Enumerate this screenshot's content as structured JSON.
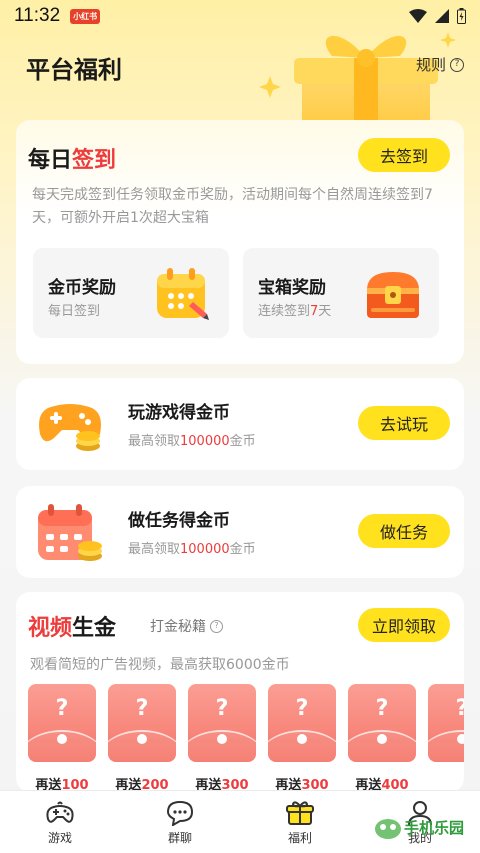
{
  "status_bar": {
    "time": "11:32",
    "badge": "小红书"
  },
  "header": {
    "title": "平台福利",
    "rules_label": "规则"
  },
  "signin": {
    "title_part1": "每日",
    "title_part2": "签到",
    "button_label": "去签到",
    "description": "每天完成签到任务领取金币奖励，活动期间每个自然周连续签到7天，可额外开启1次超大宝箱",
    "rewards": [
      {
        "title": "金币奖励",
        "subtitle": "每日签到",
        "icon": "calendar-coin-icon"
      },
      {
        "title": "宝箱奖励",
        "subtitle_pre": "连续签到",
        "subtitle_highlight": "7",
        "subtitle_post": "天",
        "icon": "treasure-chest-icon"
      }
    ]
  },
  "tasks": [
    {
      "title": "玩游戏得金币",
      "sub_pre": "最高领取",
      "sub_highlight": "100000",
      "sub_post": "金币",
      "button_label": "去试玩",
      "icon": "gamepad-coin-icon"
    },
    {
      "title": "做任务得金币",
      "sub_pre": "最高领取",
      "sub_highlight": "100000",
      "sub_post": "金币",
      "button_label": "做任务",
      "icon": "task-calendar-icon"
    }
  ],
  "video": {
    "title_part1": "视频",
    "title_part2": "生金",
    "tip_label": "打金秘籍",
    "button_label": "立即领取",
    "description": "观看简短的广告视频，最高获取6000金币",
    "envelopes": [
      {
        "symbol": "?",
        "label_pre": "再送",
        "label_highlight": "100"
      },
      {
        "symbol": "?",
        "label_pre": "再送",
        "label_highlight": "200"
      },
      {
        "symbol": "?",
        "label_pre": "再送",
        "label_highlight": "300"
      },
      {
        "symbol": "?",
        "label_pre": "再送",
        "label_highlight": "300"
      },
      {
        "symbol": "?",
        "label_pre": "再送",
        "label_highlight": "400"
      },
      {
        "symbol": "?",
        "label_pre": "",
        "label_highlight": ""
      }
    ]
  },
  "tabbar": [
    {
      "label": "游戏",
      "icon": "gamepad-icon"
    },
    {
      "label": "群聊",
      "icon": "chat-bubble-icon"
    },
    {
      "label": "福利",
      "icon": "gift-icon"
    },
    {
      "label": "我的",
      "icon": "user-icon"
    }
  ],
  "watermark": {
    "text": "手机乐园"
  },
  "colors": {
    "accent_yellow": "#ffe11d",
    "highlight_red": "#ee3c3c",
    "envelope_red": "#f5766a"
  }
}
